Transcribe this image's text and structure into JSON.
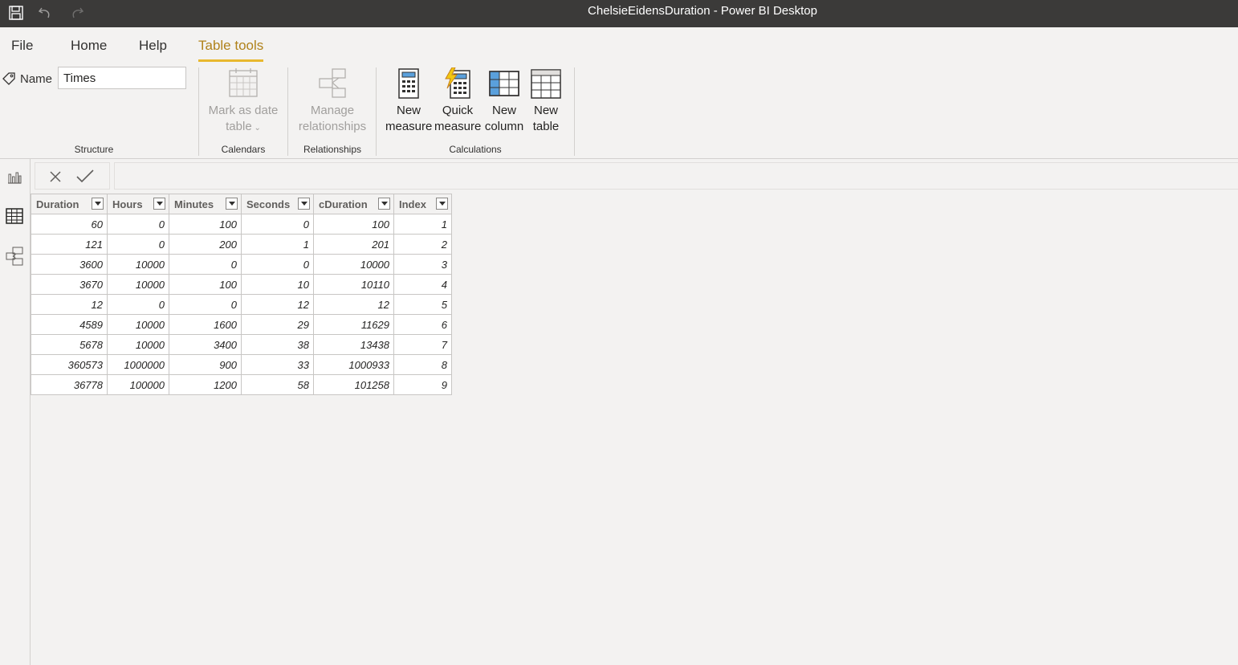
{
  "window": {
    "title": "ChelsieEidensDuration - Power BI Desktop"
  },
  "quick_access": {
    "save_icon": "save-icon",
    "undo_icon": "undo-icon",
    "redo_icon": "redo-icon"
  },
  "tabs": [
    {
      "label": "File"
    },
    {
      "label": "Home"
    },
    {
      "label": "Help"
    },
    {
      "label": "Table tools",
      "active": true
    }
  ],
  "ribbon": {
    "structure": {
      "name_label": "Name",
      "name_value": "Times",
      "group_label": "Structure"
    },
    "calendars": {
      "mark_as_date_line1": "Mark as date",
      "mark_as_date_line2": "table",
      "group_label": "Calendars"
    },
    "relationships": {
      "manage_line1": "Manage",
      "manage_line2": "relationships",
      "group_label": "Relationships"
    },
    "calculations": {
      "new_measure_line1": "New",
      "new_measure_line2": "measure",
      "quick_measure_line1": "Quick",
      "quick_measure_line2": "measure",
      "new_column_line1": "New",
      "new_column_line2": "column",
      "new_table_line1": "New",
      "new_table_line2": "table",
      "group_label": "Calculations"
    }
  },
  "accent_color": "#e8b82e",
  "table": {
    "columns": [
      "Duration",
      "Hours",
      "Minutes",
      "Seconds",
      "cDuration",
      "Index"
    ],
    "rows": [
      [
        "60",
        "0",
        "100",
        "0",
        "100",
        "1"
      ],
      [
        "121",
        "0",
        "200",
        "1",
        "201",
        "2"
      ],
      [
        "3600",
        "10000",
        "0",
        "0",
        "10000",
        "3"
      ],
      [
        "3670",
        "10000",
        "100",
        "10",
        "10110",
        "4"
      ],
      [
        "12",
        "0",
        "0",
        "12",
        "12",
        "5"
      ],
      [
        "4589",
        "10000",
        "1600",
        "29",
        "11629",
        "6"
      ],
      [
        "5678",
        "10000",
        "3400",
        "38",
        "13438",
        "7"
      ],
      [
        "360573",
        "1000000",
        "900",
        "33",
        "1000933",
        "8"
      ],
      [
        "36778",
        "100000",
        "1200",
        "58",
        "101258",
        "9"
      ]
    ]
  }
}
